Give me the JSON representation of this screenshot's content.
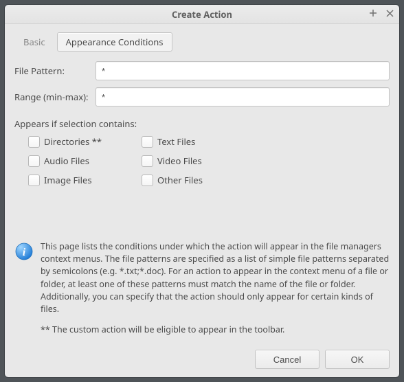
{
  "window": {
    "title": "Create Action"
  },
  "tabs": {
    "basic": "Basic",
    "appearance": "Appearance Conditions"
  },
  "fields": {
    "file_pattern_label": "File Pattern:",
    "file_pattern_value": "*",
    "range_label": "Range (min-max):",
    "range_value": "*"
  },
  "appears": {
    "section_label": "Appears if selection contains:",
    "items": [
      "Directories **",
      "Text Files",
      "Audio Files",
      "Video Files",
      "Image Files",
      "Other Files"
    ]
  },
  "info": {
    "paragraph": "This page lists the conditions under which the action will appear in the file managers context menus. The file patterns are specified as a list of simple file patterns separated by semicolons (e.g. *.txt;*.doc). For an action to appear in the context menu of a file or folder, at least one of these patterns must match the name of the file or folder. Additionally, you can specify that the action should only appear for certain kinds of files.",
    "footnote": "** The custom action will be eligible to appear in the toolbar."
  },
  "buttons": {
    "cancel": "Cancel",
    "ok": "OK"
  }
}
